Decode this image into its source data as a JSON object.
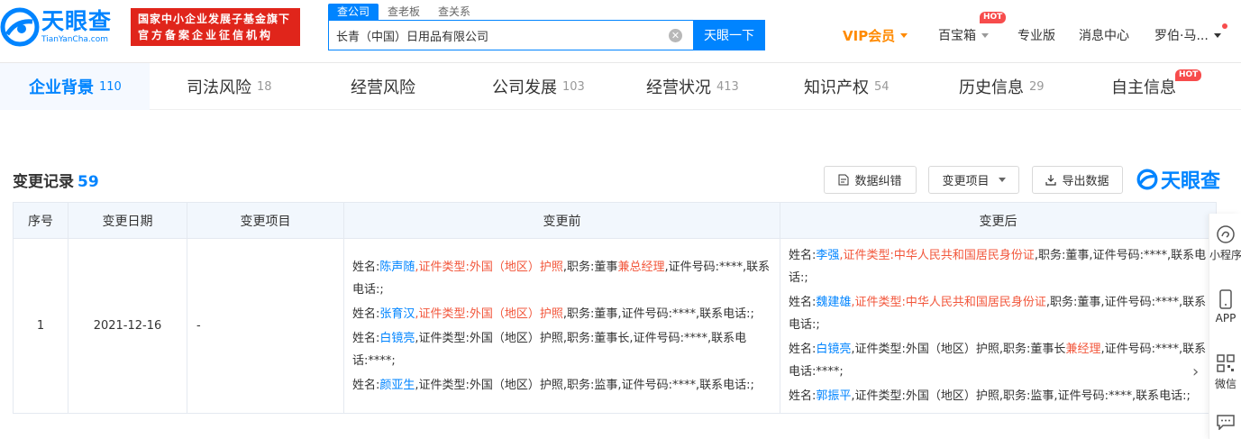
{
  "brand": {
    "name_cn": "天眼查",
    "name_en": "TianYanCha.com",
    "badge_line1": "国家中小企业发展子基金旗下",
    "badge_line2": "官方备案企业征信机构",
    "small_name": "天眼查"
  },
  "search": {
    "tabs": [
      "查公司",
      "查老板",
      "查关系"
    ],
    "active_tab": "查公司",
    "value": "长青（中国）日用品有限公司",
    "button": "天眼一下",
    "clear_icon": "clear-circle-icon"
  },
  "topnav": {
    "vip": "VIP会员",
    "baibaoxiang": "百宝箱",
    "hot": "HOT",
    "pro": "专业版",
    "messages": "消息中心",
    "user": "罗伯·马..."
  },
  "tabs": [
    {
      "label": "企业背景",
      "count": "110",
      "active": true
    },
    {
      "label": "司法风险",
      "count": "18"
    },
    {
      "label": "经营风险",
      "count": ""
    },
    {
      "label": "公司发展",
      "count": "103"
    },
    {
      "label": "经营状况",
      "count": "413"
    },
    {
      "label": "知识产权",
      "count": "54"
    },
    {
      "label": "历史信息",
      "count": "29"
    },
    {
      "label": "自主信息",
      "count": "",
      "hot": "HOT"
    }
  ],
  "section": {
    "title": "变更记录",
    "count": "59",
    "btn_correct": "数据纠错",
    "btn_item": "变更项目",
    "btn_export": "导出数据"
  },
  "table": {
    "headers": [
      "序号",
      "变更日期",
      "变更项目",
      "变更前",
      "变更后"
    ],
    "row": {
      "index": "1",
      "date": "2021-12-16",
      "item": "-"
    }
  },
  "side": {
    "mini": "小程序",
    "app": "APP",
    "wechat": "微信"
  }
}
